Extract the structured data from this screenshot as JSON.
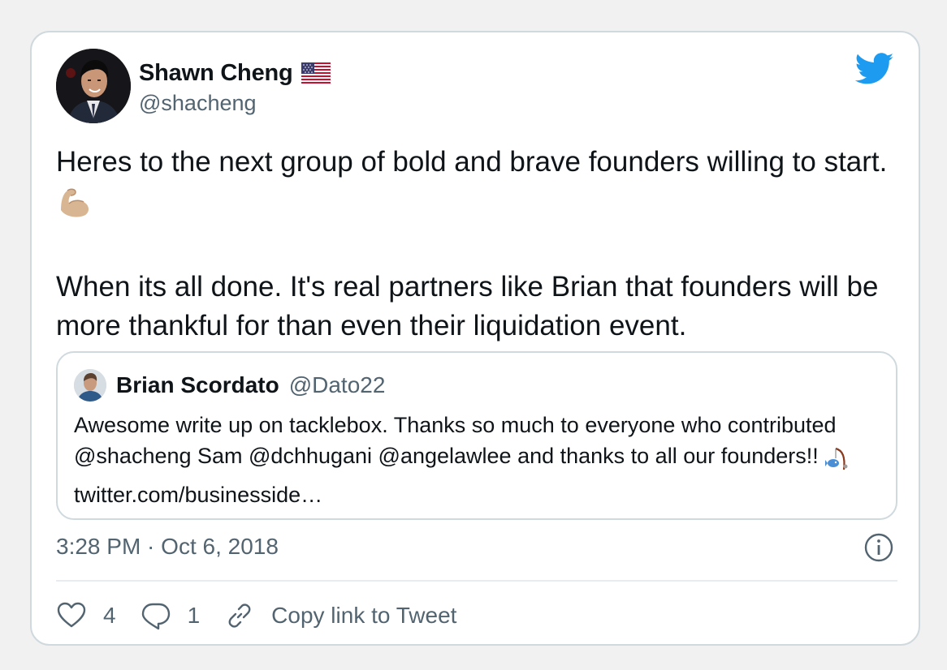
{
  "tweet": {
    "author": {
      "name": "Shawn Cheng",
      "handle": "@shacheng",
      "flag_icon": "us-flag-icon"
    },
    "text": {
      "line1": "Heres to the next group of bold and brave founders willing to start.",
      "line1_emoji": "flexed-biceps-icon",
      "line2": "When its all done. It's real partners like Brian that founders will be more thankful for than even their liquidation event."
    },
    "quoted": {
      "name": "Brian Scordato",
      "handle": "@Dato22",
      "text_before_emoji": "Awesome write up on tacklebox. Thanks so much to everyone who contributed @shacheng Sam @dchhugani @angelawlee and thanks to all our founders!! ",
      "emoji": "fishing-pole-icon",
      "link": "twitter.com/businesside…"
    },
    "timestamp": "3:28 PM · Oct 6, 2018",
    "actions": {
      "likes": "4",
      "replies": "1",
      "copy_link": "Copy link to Tweet"
    }
  },
  "colors": {
    "twitter_blue": "#1d9bf0",
    "secondary_text": "#536471",
    "border": "#cfd9de"
  }
}
